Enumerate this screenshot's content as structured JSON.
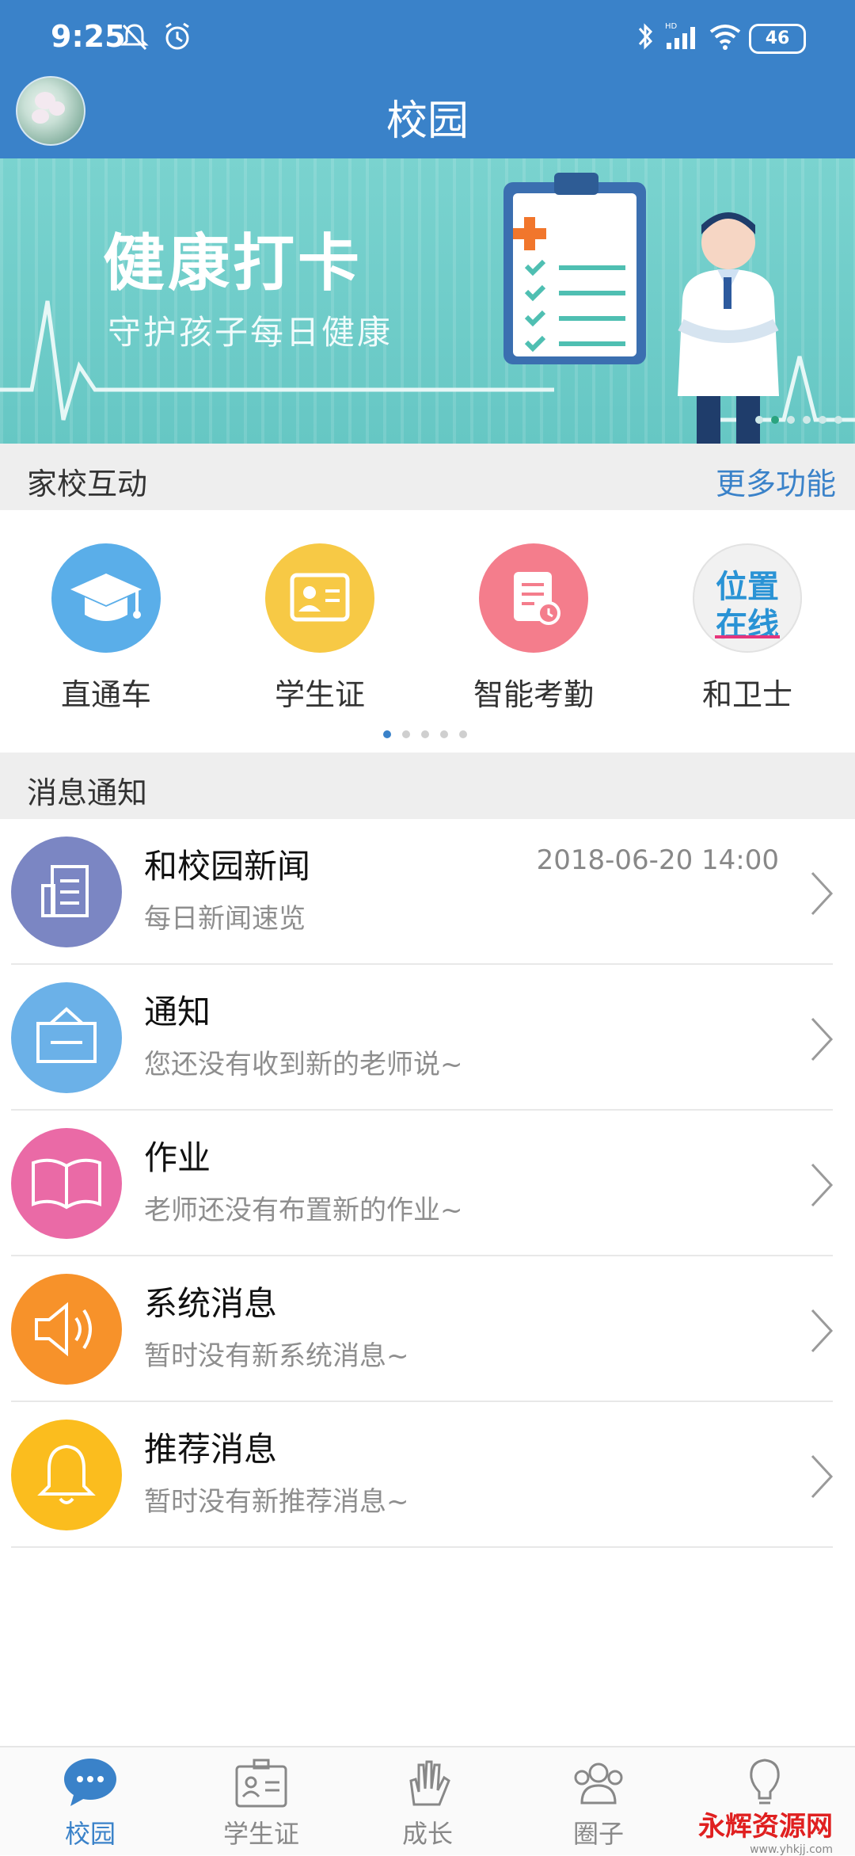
{
  "status_bar": {
    "time": "9:25",
    "battery": "46"
  },
  "app_bar": {
    "title": "校园"
  },
  "banner": {
    "title": "健康打卡",
    "subtitle": "守护孩子每日健康",
    "page_count": 6,
    "active_index": 1
  },
  "home_school": {
    "header": "家校互动",
    "more": "更多功能",
    "items": [
      {
        "label": "直通车",
        "color": "#5aaee9",
        "icon": "graduation-cap-icon"
      },
      {
        "label": "学生证",
        "color": "#f7c945",
        "icon": "id-card-icon"
      },
      {
        "label": "智能考勤",
        "color": "#f47d8c",
        "icon": "attendance-icon"
      },
      {
        "label": "和卫士",
        "icon": "location-online-logo",
        "logo_line1": "位置",
        "logo_line2": "在线"
      }
    ],
    "pager_count": 5,
    "pager_active": 0
  },
  "messages": {
    "header": "消息通知",
    "items": [
      {
        "title": "和校园新闻",
        "subtitle": "每日新闻速览",
        "time": "2018-06-20 14:00",
        "color": "#7b86c3",
        "icon": "news-icon"
      },
      {
        "title": "通知",
        "subtitle": "您还没有收到新的老师说~",
        "time": "",
        "color": "#6bb1e8",
        "icon": "notice-board-icon"
      },
      {
        "title": "作业",
        "subtitle": "老师还没有布置新的作业~",
        "time": "",
        "color": "#ea6aa6",
        "icon": "book-icon"
      },
      {
        "title": "系统消息",
        "subtitle": "暂时没有新系统消息~",
        "time": "",
        "color": "#f7922a",
        "icon": "speaker-icon"
      },
      {
        "title": "推荐消息",
        "subtitle": "暂时没有新推荐消息~",
        "time": "",
        "color": "#fbbd1e",
        "icon": "bell-icon"
      }
    ]
  },
  "tab_bar": {
    "items": [
      {
        "label": "校园",
        "active": true
      },
      {
        "label": "学生证",
        "active": false
      },
      {
        "label": "成长",
        "active": false
      },
      {
        "label": "圈子",
        "active": false
      },
      {
        "label": "",
        "active": false
      }
    ]
  },
  "watermark": {
    "text": "永辉资源网",
    "sub": "www.yhkjj.com"
  },
  "colors": {
    "primary": "#3a82c9",
    "banner": "#6ccac6"
  }
}
